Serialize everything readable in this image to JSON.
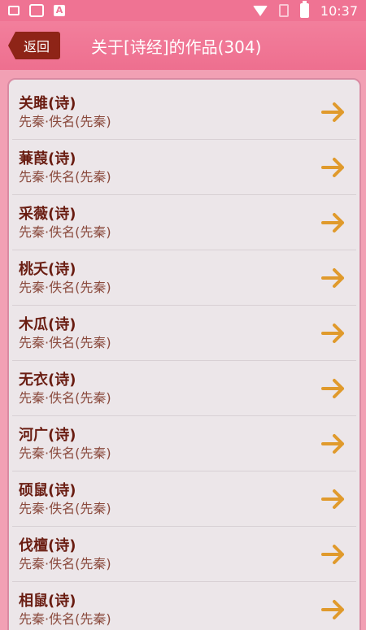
{
  "status_bar": {
    "time": "10:37",
    "a_icon_label": "A"
  },
  "header": {
    "back_label": "返回",
    "title": "关于[诗经]的作品(304)"
  },
  "colors": {
    "accent": "#ee6f8f",
    "back_button": "#8e2417",
    "arrow": "#e09a2c",
    "title_text": "#6a1d12"
  },
  "items": [
    {
      "title": "关雎(诗)",
      "subtitle": "先秦·佚名(先秦)"
    },
    {
      "title": "蒹葭(诗)",
      "subtitle": "先秦·佚名(先秦)"
    },
    {
      "title": "采薇(诗)",
      "subtitle": "先秦·佚名(先秦)"
    },
    {
      "title": "桃夭(诗)",
      "subtitle": "先秦·佚名(先秦)"
    },
    {
      "title": "木瓜(诗)",
      "subtitle": "先秦·佚名(先秦)"
    },
    {
      "title": "无衣(诗)",
      "subtitle": "先秦·佚名(先秦)"
    },
    {
      "title": "河广(诗)",
      "subtitle": "先秦·佚名(先秦)"
    },
    {
      "title": "硕鼠(诗)",
      "subtitle": "先秦·佚名(先秦)"
    },
    {
      "title": "伐檀(诗)",
      "subtitle": "先秦·佚名(先秦)"
    },
    {
      "title": "相鼠(诗)",
      "subtitle": "先秦·佚名(先秦)"
    }
  ]
}
